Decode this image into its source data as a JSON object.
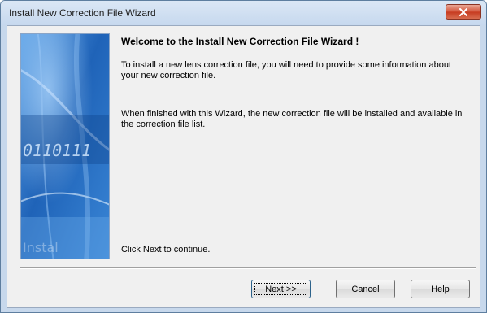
{
  "window": {
    "title": "Install New Correction File Wizard",
    "close_icon": "close-icon"
  },
  "sidebar_image": {
    "text_binary": "0110111",
    "text_faded": "Instal"
  },
  "content": {
    "heading": "Welcome to the Install New Correction File Wizard !",
    "paragraph1": "To install a new lens correction file, you will need to provide some information about your new correction file.",
    "paragraph2": "When finished with this Wizard, the new correction file will be installed and available in the correction file list.",
    "continue_text": "Click Next to continue."
  },
  "buttons": {
    "next": "Next >>",
    "cancel": "Cancel",
    "help_first": "H",
    "help_rest": "elp"
  },
  "colors": {
    "accent": "#2c628b",
    "image_blue": "#1f63b8",
    "close_red": "#c63a1f"
  }
}
